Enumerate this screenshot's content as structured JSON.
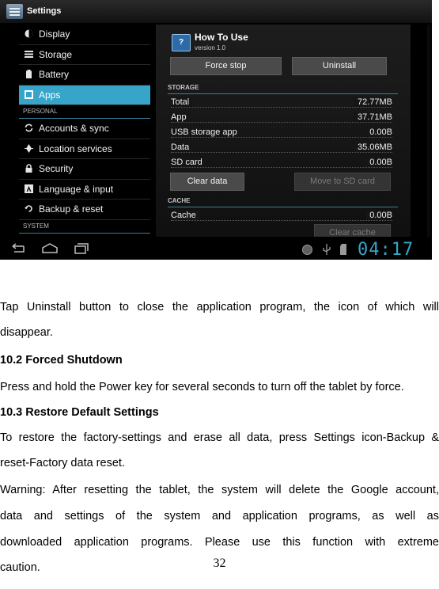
{
  "screenshot": {
    "title": "Settings",
    "sidebar": {
      "items": [
        {
          "label": "Display",
          "icon": "display-icon"
        },
        {
          "label": "Storage",
          "icon": "storage-icon"
        },
        {
          "label": "Battery",
          "icon": "battery-icon"
        },
        {
          "label": "Apps",
          "icon": "apps-icon",
          "selected": true
        }
      ],
      "section_personal": "PERSONAL",
      "personal_items": [
        {
          "label": "Accounts & sync",
          "icon": "sync-icon"
        },
        {
          "label": "Location services",
          "icon": "location-icon"
        },
        {
          "label": "Security",
          "icon": "lock-icon"
        },
        {
          "label": "Language & input",
          "icon": "keyboard-icon"
        },
        {
          "label": "Backup & reset",
          "icon": "backup-icon"
        }
      ],
      "section_system": "SYSTEM"
    },
    "app": {
      "name": "How To Use",
      "version": "version 1.0",
      "force_stop": "Force stop",
      "uninstall": "Uninstall"
    },
    "storage": {
      "header": "STORAGE",
      "rows": [
        {
          "label": "Total",
          "value": "72.77MB"
        },
        {
          "label": "App",
          "value": "37.71MB"
        },
        {
          "label": "USB storage app",
          "value": "0.00B"
        },
        {
          "label": "Data",
          "value": "35.06MB"
        },
        {
          "label": "SD card",
          "value": "0.00B"
        }
      ],
      "clear_data": "Clear data",
      "move_to_sd": "Move to SD card"
    },
    "cache": {
      "header": "CACHE",
      "label": "Cache",
      "value": "0.00B",
      "clear_cache": "Clear cache"
    },
    "clock": "04:17",
    "accent_color": "#36a5c9"
  },
  "document": {
    "para_uninstall_line1": "Tap Uninstall button to close the application program, the icon of which will",
    "para_uninstall_line2": "disappear.",
    "heading_shutdown": "10.2 Forced Shutdown",
    "para_shutdown": "Press and hold the Power key for several seconds to turn off the tablet by force.",
    "heading_restore": "10.3 Restore Default Settings",
    "para_restore_line1": "To restore the factory-settings and erase all data, press Settings icon-Backup &",
    "para_restore_line2": "reset-Factory data reset.",
    "warning_line1": "Warning: After resetting the tablet, the system will delete the Google account,",
    "warning_line2": "data and settings of the system and application programs, as well as",
    "warning_line3": "downloaded application programs. Please use this function with extreme",
    "warning_line4": "caution.",
    "page_number": "32"
  }
}
